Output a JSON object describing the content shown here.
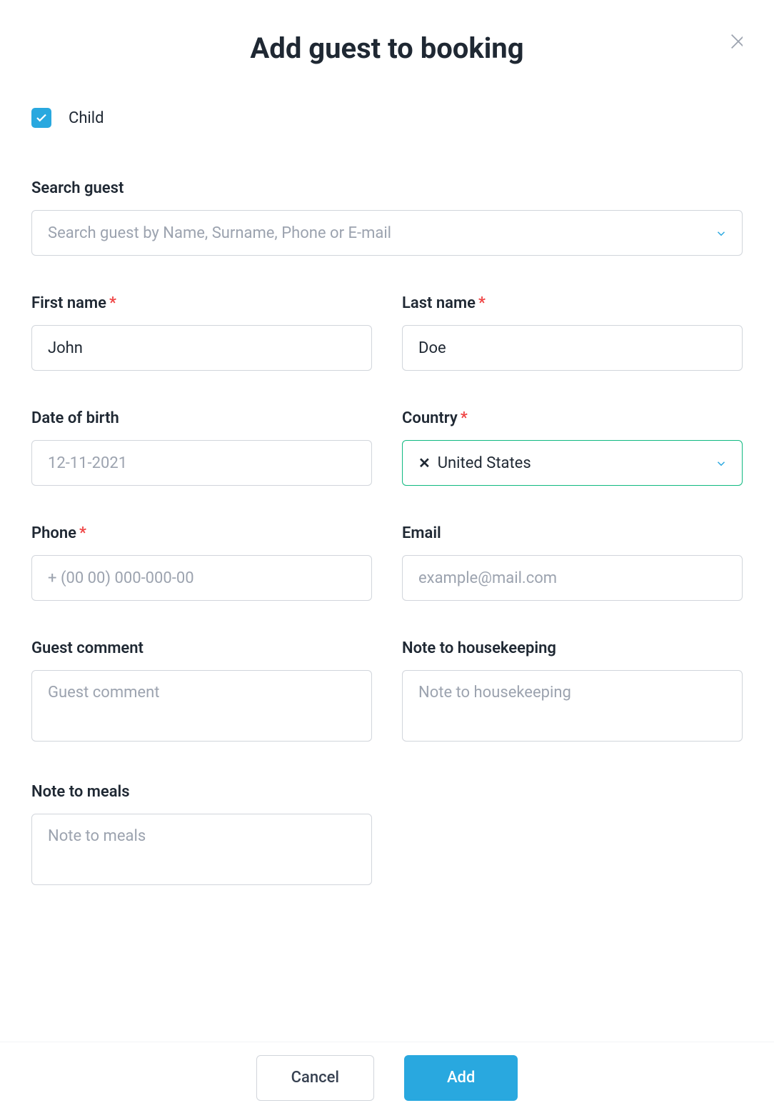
{
  "modal": {
    "title": "Add guest to booking"
  },
  "checkbox": {
    "child_label": "Child",
    "child_checked": true
  },
  "search": {
    "label": "Search guest",
    "placeholder": "Search guest by Name, Surname, Phone or E-mail"
  },
  "fields": {
    "first_name": {
      "label": "First name",
      "value": "John",
      "required": true
    },
    "last_name": {
      "label": "Last name",
      "value": "Doe",
      "required": true
    },
    "dob": {
      "label": "Date of birth",
      "placeholder": "12-11-2021"
    },
    "country": {
      "label": "Country",
      "value": "United States",
      "required": true
    },
    "phone": {
      "label": "Phone",
      "placeholder": "+ (00 00) 000-000-00",
      "required": true
    },
    "email": {
      "label": "Email",
      "placeholder": "example@mail.com"
    },
    "guest_comment": {
      "label": "Guest comment",
      "placeholder": "Guest comment"
    },
    "note_housekeeping": {
      "label": "Note to housekeeping",
      "placeholder": "Note to housekeeping"
    },
    "note_meals": {
      "label": "Note to meals",
      "placeholder": "Note to meals"
    }
  },
  "footer": {
    "cancel": "Cancel",
    "add": "Add"
  }
}
